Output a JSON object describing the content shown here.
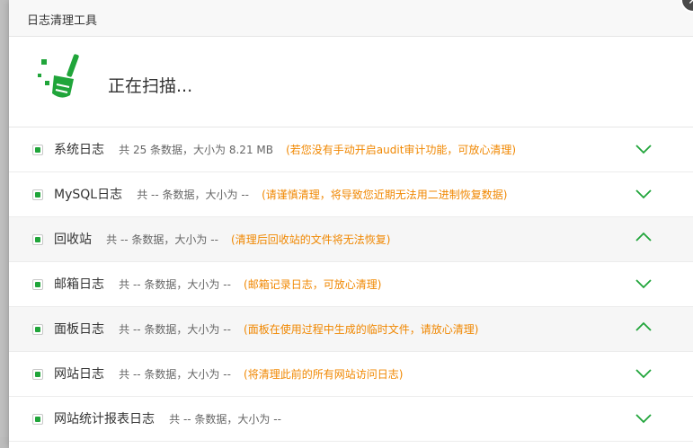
{
  "dialog": {
    "title": "日志清理工具",
    "close_symbol": "✕",
    "scan_status": "正在扫描..."
  },
  "colors": {
    "accent_green": "#20a53a",
    "note_orange": "#f08700"
  },
  "icons": {
    "broom": "broom-icon",
    "close": "close-icon",
    "expand": "chevron-down-icon",
    "collapse": "chevron-up-icon"
  },
  "log_items": [
    {
      "name": "系统日志",
      "stats": "共 25 条数据，大小为 8.21 MB",
      "note": "(若您没有手动开启audit审计功能，可放心清理)",
      "checked": true,
      "chevron": "down"
    },
    {
      "name": "MySQL日志",
      "stats": "共 -- 条数据，大小为 --",
      "note": "(请谨慎清理，将导致您近期无法用二进制恢复数据)",
      "checked": true,
      "chevron": "down"
    },
    {
      "name": "回收站",
      "stats": "共 -- 条数据，大小为 --",
      "note": "(清理后回收站的文件将无法恢复)",
      "checked": true,
      "chevron": "up"
    },
    {
      "name": "邮箱日志",
      "stats": "共 -- 条数据，大小为 --",
      "note": "(邮箱记录日志，可放心清理)",
      "checked": true,
      "chevron": "down"
    },
    {
      "name": "面板日志",
      "stats": "共 -- 条数据，大小为 --",
      "note": "(面板在使用过程中生成的临时文件，请放心清理)",
      "checked": true,
      "chevron": "up"
    },
    {
      "name": "网站日志",
      "stats": "共 -- 条数据，大小为 --",
      "note": "(将清理此前的所有网站访问日志)",
      "checked": true,
      "chevron": "down"
    },
    {
      "name": "网站统计报表日志",
      "stats": "共 -- 条数据，大小为 --",
      "note": "",
      "checked": true,
      "chevron": "down"
    }
  ]
}
